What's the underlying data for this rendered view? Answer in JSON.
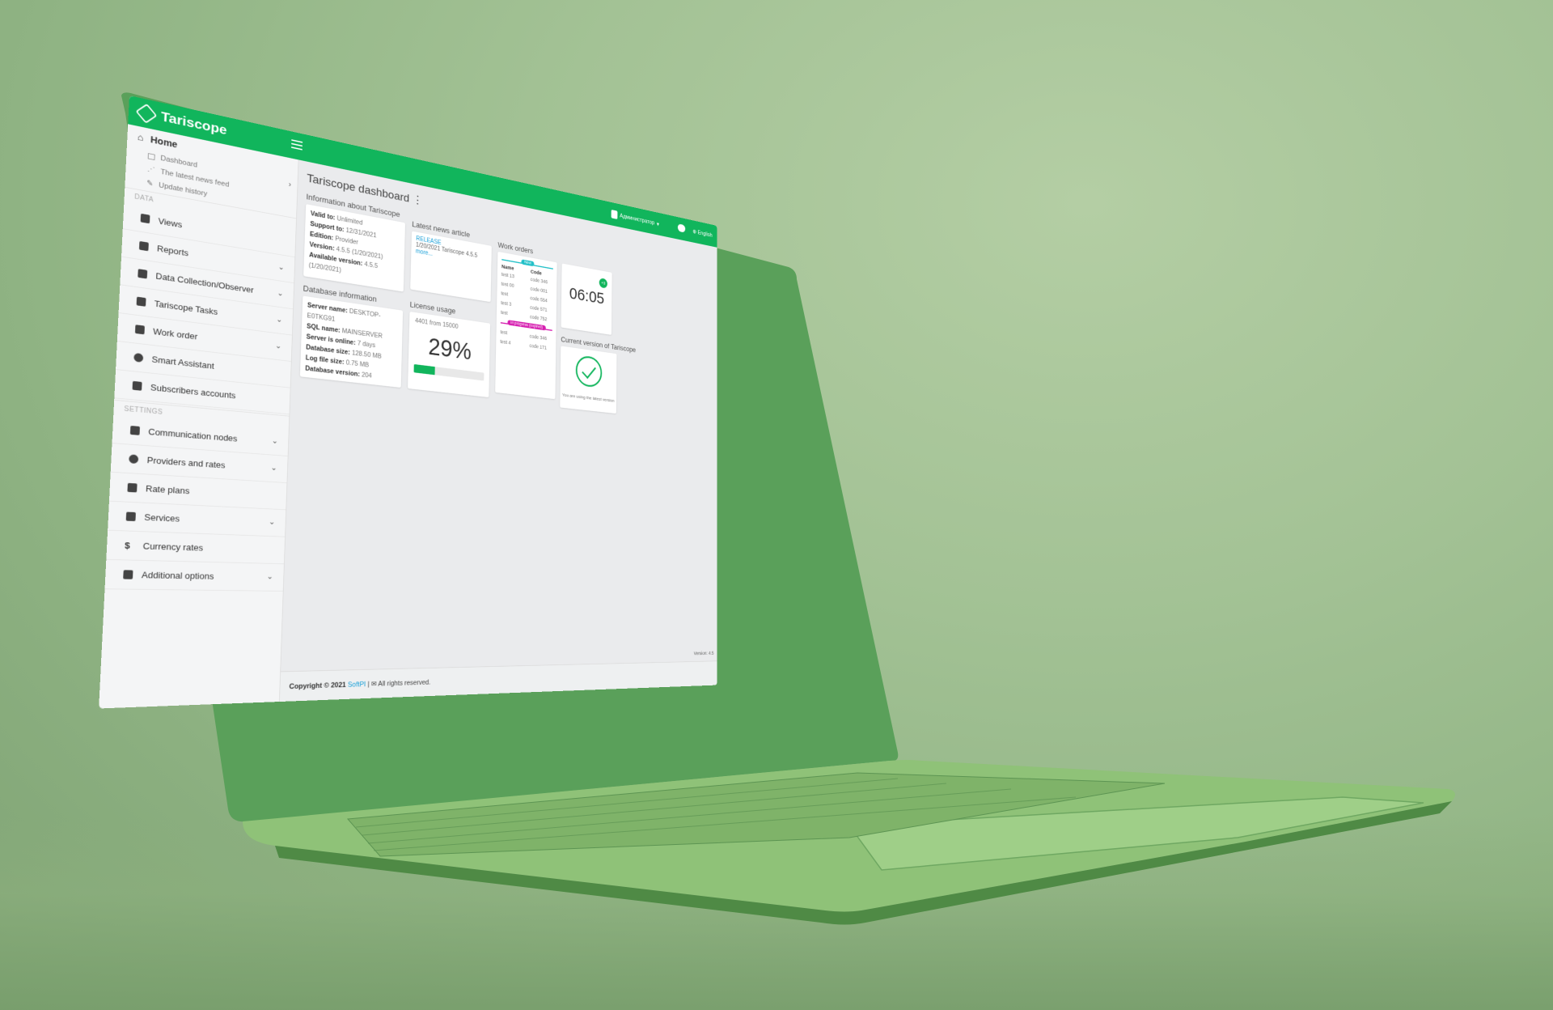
{
  "app": {
    "brand": "Tariscope",
    "user_name": "Администратор",
    "lang": "English"
  },
  "colors": {
    "accent": "#11b55c",
    "link": "#1aa0d8",
    "in_progress": "#d61fb0",
    "new": "#22c0c8"
  },
  "sidebar": {
    "home": "Home",
    "sub_items": [
      {
        "label": "Dashboard",
        "icon": "monitor-icon"
      },
      {
        "label": "The latest news feed",
        "icon": "rss-icon"
      },
      {
        "label": "Update history",
        "icon": "edit-icon"
      }
    ],
    "data_section": "DATA",
    "data_items": [
      {
        "label": "Views",
        "icon": "table-icon",
        "chevron": false
      },
      {
        "label": "Reports",
        "icon": "report-icon",
        "chevron": true
      },
      {
        "label": "Data Collection/Observer",
        "icon": "collection-icon",
        "chevron": true
      },
      {
        "label": "Tariscope Tasks",
        "icon": "tasks-icon",
        "chevron": true
      },
      {
        "label": "Work order",
        "icon": "user-icon",
        "chevron": true
      },
      {
        "label": "Smart Assistant",
        "icon": "info-icon",
        "chevron": false
      },
      {
        "label": "Subscribers accounts",
        "icon": "accounts-icon",
        "chevron": false
      }
    ],
    "settings_section": "SETTINGS",
    "settings_items": [
      {
        "label": "Communication nodes",
        "icon": "nodes-icon",
        "chevron": true
      },
      {
        "label": "Providers and rates",
        "icon": "globe-icon",
        "chevron": true
      },
      {
        "label": "Rate plans",
        "icon": "plan-icon",
        "chevron": false
      },
      {
        "label": "Services",
        "icon": "services-icon",
        "chevron": true
      },
      {
        "label": "Currency rates",
        "icon": "dollar-icon",
        "chevron": false
      },
      {
        "label": "Additional options",
        "icon": "rocket-icon",
        "chevron": true
      }
    ]
  },
  "main": {
    "title": "Tariscope dashboard",
    "info": {
      "title": "Information about Tariscope",
      "lines": [
        {
          "k": "Valid to:",
          "v": "Unlimited"
        },
        {
          "k": "Support to:",
          "v": "12/31/2021"
        },
        {
          "k": "Edition:",
          "v": "Provider"
        },
        {
          "k": "Version:",
          "v": "4.5.5 (1/20/2021)"
        },
        {
          "k": "Available version:",
          "v": "4.5.5 (1/20/2021)"
        }
      ]
    },
    "news": {
      "title": "Latest news article",
      "tag": "RELEASE",
      "text": "1/20/2021  Tariscope 4.5.5",
      "more": "more..."
    },
    "work_orders": {
      "title": "Work orders",
      "new_label": "New",
      "col_name": "Name",
      "col_code": "Code",
      "new_rows": [
        {
          "name": "test 13",
          "code": "code 346"
        },
        {
          "name": "test 00",
          "code": "code 001"
        },
        {
          "name": "test",
          "code": "code 554"
        },
        {
          "name": "test 3",
          "code": "code 571"
        },
        {
          "name": "test",
          "code": "code 752"
        }
      ],
      "progress_label": "In progress (expired)",
      "progress_rows": [
        {
          "name": "test",
          "code": "code 346"
        },
        {
          "name": "test 4",
          "code": "code 171"
        }
      ]
    },
    "clock": {
      "time": "06:05",
      "badge": "+3"
    },
    "database": {
      "title": "Database information",
      "lines": [
        {
          "k": "Server name:",
          "v": "DESKTOP-E0TKG91"
        },
        {
          "k": "SQL name:",
          "v": "MAINSERVER"
        },
        {
          "k": "Server is online:",
          "v": "7 days"
        },
        {
          "k": "Database size:",
          "v": "128.50 MB"
        },
        {
          "k": "Log file size:",
          "v": "0.75 MB"
        },
        {
          "k": "Database version:",
          "v": "204"
        }
      ]
    },
    "license": {
      "title": "License usage",
      "subtitle": "4401 from 15000",
      "percent_text": "29%",
      "fraction": 0.29
    },
    "current_version": {
      "title": "Current version of Tariscope",
      "note": "You are using the latest version"
    }
  },
  "footer": {
    "copyright": "Copyright © 2021",
    "company": "SoftPI",
    "rights": "All rights reserved.",
    "version": "Version: 4.5"
  }
}
